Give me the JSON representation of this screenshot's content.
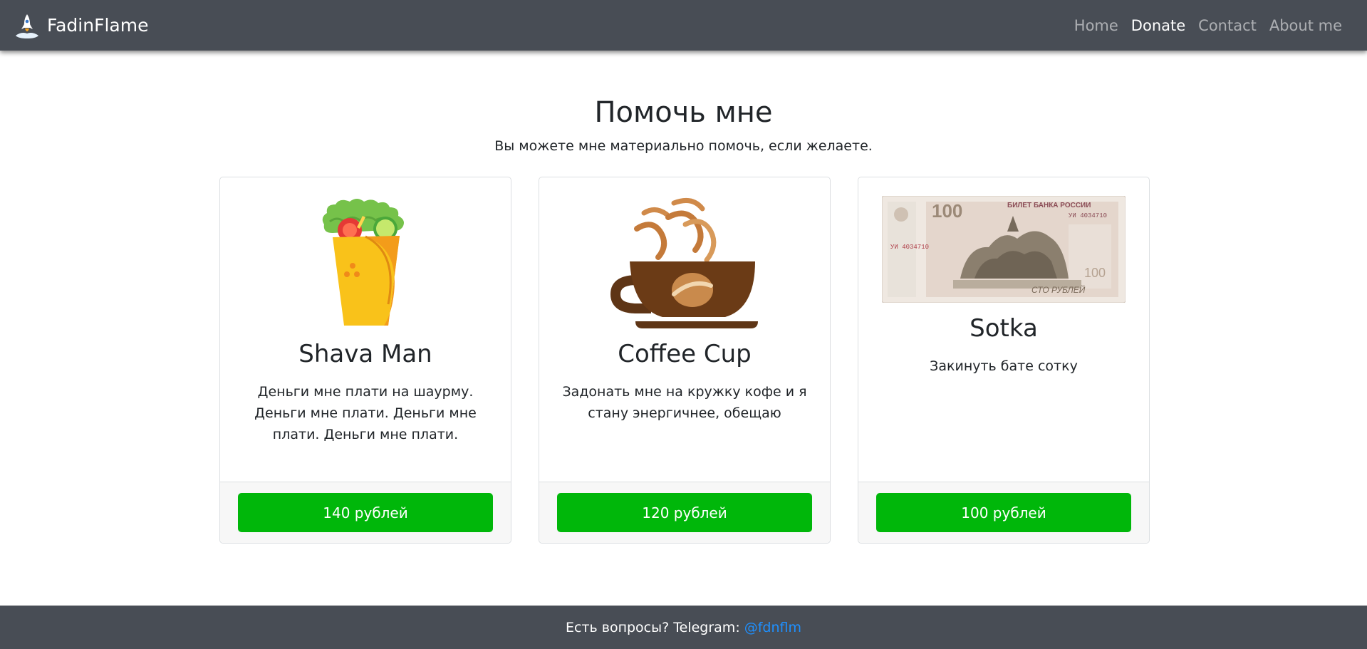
{
  "navbar": {
    "brand": "FadinFlame",
    "links": [
      {
        "label": "Home"
      },
      {
        "label": "Donate"
      },
      {
        "label": "Contact"
      },
      {
        "label": "About me"
      }
    ]
  },
  "header": {
    "title": "Помочь мне",
    "subtitle": "Вы можете мне материально помочь, если желаете."
  },
  "cards": [
    {
      "title": "Shava Man",
      "text": "Деньги мне плати на шаурму. Деньги мне плати. Деньги мне плати. Деньги мне плати.",
      "button": "140 рублей",
      "icon": "shawarma-icon"
    },
    {
      "title": "Coffee Cup",
      "text": "Задонать мне на кружку кофе и я стану энергичнее, обещаю",
      "button": "120 рублей",
      "icon": "coffee-cup-icon"
    },
    {
      "title": "Sotka",
      "text": "Закинуть бате сотку",
      "button": "100 рублей",
      "icon": "banknote-image",
      "banknote": {
        "denomination": "100",
        "heading": "БИЛЕТ БАНКА РОССИИ",
        "serial": "УИ 4034710",
        "caption": "СТО РУБЛЕЙ"
      }
    }
  ],
  "footer": {
    "text": "Есть вопросы? Telegram:",
    "link": "@fdnflm"
  },
  "colors": {
    "navbar": "#484d55",
    "button": "#00b70a",
    "link": "#1e90ff"
  }
}
